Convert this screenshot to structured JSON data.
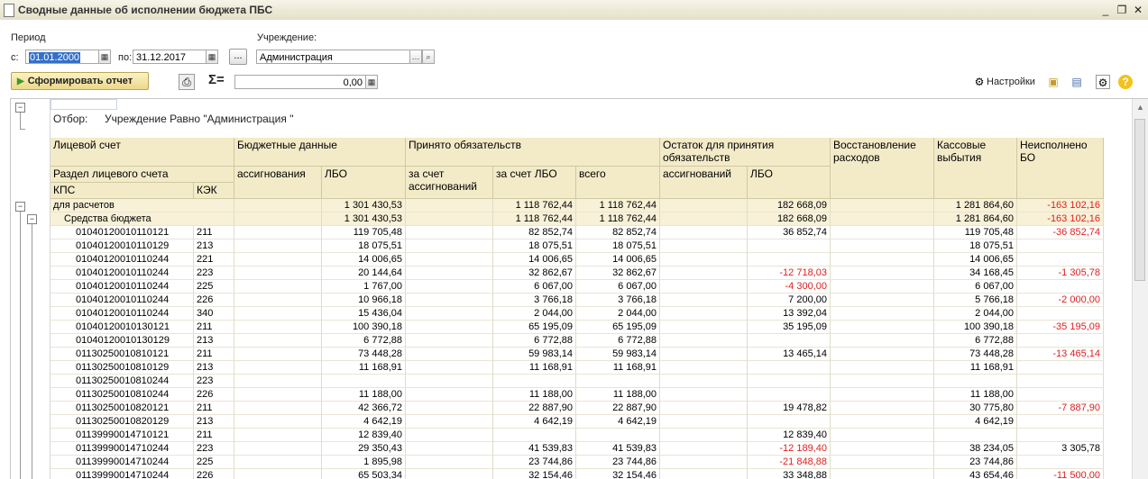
{
  "window": {
    "title": "Сводные данные об исполнении бюджета ПБС"
  },
  "filters": {
    "period_label": "Период",
    "from_label": "с:",
    "from_value": "01.01.2000",
    "to_label": "по:",
    "to_value": "31.12.2017",
    "dots_label": "...",
    "institution_label": "Учреждение:",
    "institution_value": "Администрация",
    "sum_label": "Σ=",
    "sum_value": "0,00"
  },
  "toolbar": {
    "run_label": "Сформировать отчет",
    "settings_label": "Настройки"
  },
  "report": {
    "filter_label": "Отбор:",
    "filter_value": "Учреждение Равно \"Администрация \"",
    "headers": {
      "account": "Лицевой счет",
      "budget": "Бюджетные данные",
      "accepted": "Принято обязательств",
      "remaining": "Остаток для принятия обязательств",
      "restore": "Восстановление расходов",
      "cash": "Кассовые выбытия",
      "unexecuted": "Неисполнено БО",
      "section": "Раздел лицевого счета",
      "allocations": "ассигнования",
      "lbo": "ЛБО",
      "by_alloc": "за счет ассигнований",
      "by_lbo": "за счет ЛБО",
      "total": "всего",
      "rem_alloc": "ассигнований",
      "rem_lbo": "ЛБО",
      "kps": "КПС",
      "kek": "КЭК"
    },
    "rows": [
      {
        "kps": "для расчетов",
        "kek": "",
        "alloc": "",
        "lbo": "1 301 430,53",
        "by_alloc": "",
        "by_lbo": "1 118 762,44",
        "total": "1 118 762,44",
        "rem_alloc": "",
        "rem_lbo": "182 668,09",
        "restore": "",
        "cash": "1 281 864,60",
        "unexec": "-163 102,16"
      },
      {
        "kps": "Средства бюджета",
        "kek": "",
        "alloc": "",
        "lbo": "1 301 430,53",
        "by_alloc": "",
        "by_lbo": "1 118 762,44",
        "total": "1 118 762,44",
        "rem_alloc": "",
        "rem_lbo": "182 668,09",
        "restore": "",
        "cash": "1 281 864,60",
        "unexec": "-163 102,16"
      },
      {
        "kps": "01040120010110121",
        "kek": "211",
        "alloc": "",
        "lbo": "119 705,48",
        "by_alloc": "",
        "by_lbo": "82 852,74",
        "total": "82 852,74",
        "rem_alloc": "",
        "rem_lbo": "36 852,74",
        "restore": "",
        "cash": "119 705,48",
        "unexec": "-36 852,74"
      },
      {
        "kps": "01040120010110129",
        "kek": "213",
        "alloc": "",
        "lbo": "18 075,51",
        "by_alloc": "",
        "by_lbo": "18 075,51",
        "total": "18 075,51",
        "rem_alloc": "",
        "rem_lbo": "",
        "restore": "",
        "cash": "18 075,51",
        "unexec": ""
      },
      {
        "kps": "01040120010110244",
        "kek": "221",
        "alloc": "",
        "lbo": "14 006,65",
        "by_alloc": "",
        "by_lbo": "14 006,65",
        "total": "14 006,65",
        "rem_alloc": "",
        "rem_lbo": "",
        "restore": "",
        "cash": "14 006,65",
        "unexec": ""
      },
      {
        "kps": "01040120010110244",
        "kek": "223",
        "alloc": "",
        "lbo": "20 144,64",
        "by_alloc": "",
        "by_lbo": "32 862,67",
        "total": "32 862,67",
        "rem_alloc": "",
        "rem_lbo": "-12 718,03",
        "restore": "",
        "cash": "34 168,45",
        "unexec": "-1 305,78"
      },
      {
        "kps": "01040120010110244",
        "kek": "225",
        "alloc": "",
        "lbo": "1 767,00",
        "by_alloc": "",
        "by_lbo": "6 067,00",
        "total": "6 067,00",
        "rem_alloc": "",
        "rem_lbo": "-4 300,00",
        "restore": "",
        "cash": "6 067,00",
        "unexec": ""
      },
      {
        "kps": "01040120010110244",
        "kek": "226",
        "alloc": "",
        "lbo": "10 966,18",
        "by_alloc": "",
        "by_lbo": "3 766,18",
        "total": "3 766,18",
        "rem_alloc": "",
        "rem_lbo": "7 200,00",
        "restore": "",
        "cash": "5 766,18",
        "unexec": "-2 000,00"
      },
      {
        "kps": "01040120010110244",
        "kek": "340",
        "alloc": "",
        "lbo": "15 436,04",
        "by_alloc": "",
        "by_lbo": "2 044,00",
        "total": "2 044,00",
        "rem_alloc": "",
        "rem_lbo": "13 392,04",
        "restore": "",
        "cash": "2 044,00",
        "unexec": ""
      },
      {
        "kps": "01040120010130121",
        "kek": "211",
        "alloc": "",
        "lbo": "100 390,18",
        "by_alloc": "",
        "by_lbo": "65 195,09",
        "total": "65 195,09",
        "rem_alloc": "",
        "rem_lbo": "35 195,09",
        "restore": "",
        "cash": "100 390,18",
        "unexec": "-35 195,09"
      },
      {
        "kps": "01040120010130129",
        "kek": "213",
        "alloc": "",
        "lbo": "6 772,88",
        "by_alloc": "",
        "by_lbo": "6 772,88",
        "total": "6 772,88",
        "rem_alloc": "",
        "rem_lbo": "",
        "restore": "",
        "cash": "6 772,88",
        "unexec": ""
      },
      {
        "kps": "01130250010810121",
        "kek": "211",
        "alloc": "",
        "lbo": "73 448,28",
        "by_alloc": "",
        "by_lbo": "59 983,14",
        "total": "59 983,14",
        "rem_alloc": "",
        "rem_lbo": "13 465,14",
        "restore": "",
        "cash": "73 448,28",
        "unexec": "-13 465,14"
      },
      {
        "kps": "01130250010810129",
        "kek": "213",
        "alloc": "",
        "lbo": "11 168,91",
        "by_alloc": "",
        "by_lbo": "11 168,91",
        "total": "11 168,91",
        "rem_alloc": "",
        "rem_lbo": "",
        "restore": "",
        "cash": "11 168,91",
        "unexec": ""
      },
      {
        "kps": "01130250010810244",
        "kek": "223",
        "alloc": "",
        "lbo": "",
        "by_alloc": "",
        "by_lbo": "",
        "total": "",
        "rem_alloc": "",
        "rem_lbo": "",
        "restore": "",
        "cash": "",
        "unexec": ""
      },
      {
        "kps": "01130250010810244",
        "kek": "226",
        "alloc": "",
        "lbo": "11 188,00",
        "by_alloc": "",
        "by_lbo": "11 188,00",
        "total": "11 188,00",
        "rem_alloc": "",
        "rem_lbo": "",
        "restore": "",
        "cash": "11 188,00",
        "unexec": ""
      },
      {
        "kps": "01130250010820121",
        "kek": "211",
        "alloc": "",
        "lbo": "42 366,72",
        "by_alloc": "",
        "by_lbo": "22 887,90",
        "total": "22 887,90",
        "rem_alloc": "",
        "rem_lbo": "19 478,82",
        "restore": "",
        "cash": "30 775,80",
        "unexec": "-7 887,90"
      },
      {
        "kps": "01130250010820129",
        "kek": "213",
        "alloc": "",
        "lbo": "4 642,19",
        "by_alloc": "",
        "by_lbo": "4 642,19",
        "total": "4 642,19",
        "rem_alloc": "",
        "rem_lbo": "",
        "restore": "",
        "cash": "4 642,19",
        "unexec": ""
      },
      {
        "kps": "01139990014710121",
        "kek": "211",
        "alloc": "",
        "lbo": "12 839,40",
        "by_alloc": "",
        "by_lbo": "",
        "total": "",
        "rem_alloc": "",
        "rem_lbo": "12 839,40",
        "restore": "",
        "cash": "",
        "unexec": ""
      },
      {
        "kps": "01139990014710244",
        "kek": "223",
        "alloc": "",
        "lbo": "29 350,43",
        "by_alloc": "",
        "by_lbo": "41 539,83",
        "total": "41 539,83",
        "rem_alloc": "",
        "rem_lbo": "-12 189,40",
        "restore": "",
        "cash": "38 234,05",
        "unexec": "3 305,78"
      },
      {
        "kps": "01139990014710244",
        "kek": "225",
        "alloc": "",
        "lbo": "1 895,98",
        "by_alloc": "",
        "by_lbo": "23 744,86",
        "total": "23 744,86",
        "rem_alloc": "",
        "rem_lbo": "-21 848,88",
        "restore": "",
        "cash": "23 744,86",
        "unexec": ""
      },
      {
        "kps": "01139990014710244",
        "kek": "226",
        "alloc": "",
        "lbo": "65 503,34",
        "by_alloc": "",
        "by_lbo": "32 154,46",
        "total": "32 154,46",
        "rem_alloc": "",
        "rem_lbo": "33 348,88",
        "restore": "",
        "cash": "43 654,46",
        "unexec": "-11 500,00"
      }
    ]
  }
}
